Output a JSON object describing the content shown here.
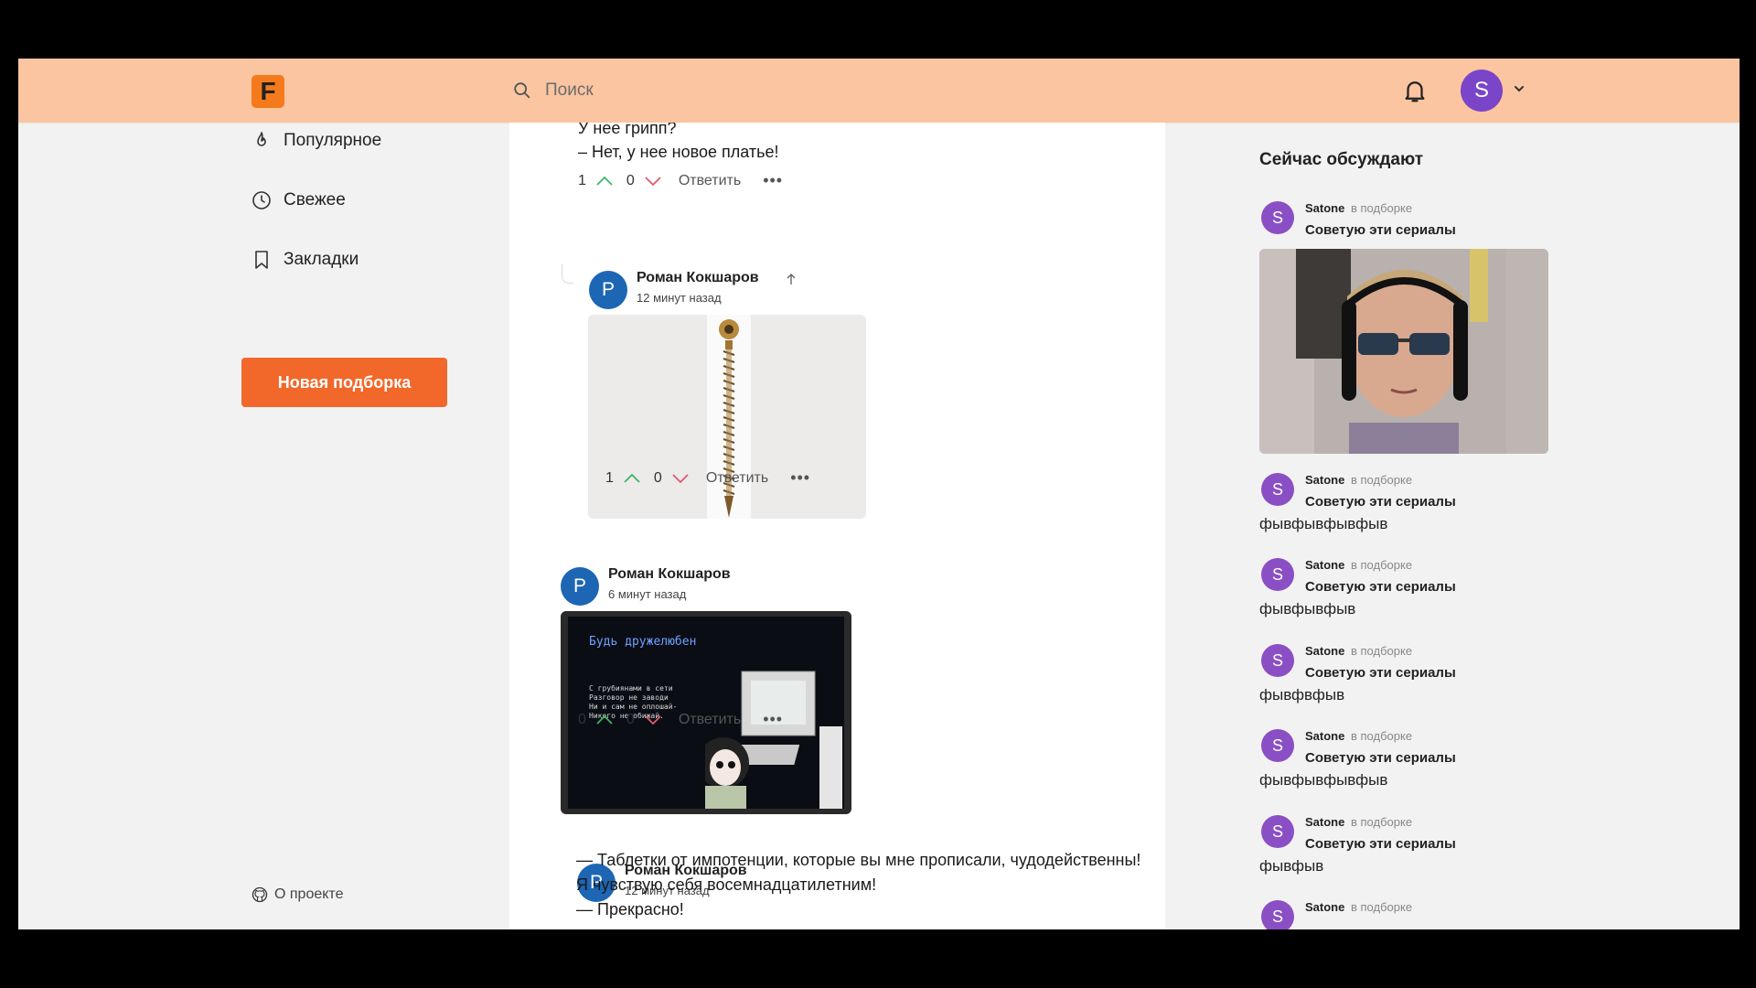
{
  "header": {
    "logo_letter": "F",
    "search_placeholder": "Поиск",
    "avatar_letter": "S"
  },
  "sidebar": {
    "items": [
      {
        "label": "Популярное",
        "icon": "flame-icon"
      },
      {
        "label": "Свежее",
        "icon": "clock-icon"
      },
      {
        "label": "Закладки",
        "icon": "bookmark-icon"
      }
    ],
    "new_button": "Новая подборка",
    "about": "О проекте"
  },
  "feed": {
    "top_text": [
      "У нее грипп?",
      "– Нет, у нее новое платье!"
    ],
    "comment0": {
      "up": "1",
      "down": "0",
      "reply": "Ответить",
      "more": "•••"
    },
    "comment1": {
      "avatar": "Р",
      "author": "Роман Кокшаров",
      "time": "12 минут назад",
      "up": "1",
      "down": "0",
      "reply": "Ответить",
      "more": "•••"
    },
    "comment2": {
      "avatar": "Р",
      "author": "Роман Кокшаров",
      "time": "6 минут назад",
      "image_title": "Будь дружелюбен",
      "image_lines": [
        "С грубиянами в сети",
        "Разговор не заводи",
        "Ни и сам не оплошай-",
        "Никого не обижай."
      ],
      "up": "0",
      "down": "0",
      "reply": "Ответить",
      "more": "•••"
    },
    "comment3": {
      "avatar": "Р",
      "author": "Роман Кокшаров",
      "time": "12 минут назад",
      "text": [
        "— Таблетки от импотенции, которые вы мне прописали, чудодейственны!",
        "Я чувствую себя восемнадцатилетним!",
        "— Прекрасно!"
      ]
    }
  },
  "right": {
    "title": "Сейчас обсуждают",
    "items": [
      {
        "avatar": "S",
        "user": "Satone",
        "in": "в подборке",
        "collection": "Советую эти сериалы",
        "text": ""
      },
      {
        "avatar": "S",
        "user": "Satone",
        "in": "в подборке",
        "collection": "Советую эти сериалы",
        "text": "фывфывфывфыв"
      },
      {
        "avatar": "S",
        "user": "Satone",
        "in": "в подборке",
        "collection": "Советую эти сериалы",
        "text": "фывфывфыв"
      },
      {
        "avatar": "S",
        "user": "Satone",
        "in": "в подборке",
        "collection": "Советую эти сериалы",
        "text": "фывфвфыв"
      },
      {
        "avatar": "S",
        "user": "Satone",
        "in": "в подборке",
        "collection": "Советую эти сериалы",
        "text": "фывфывфывфыв"
      },
      {
        "avatar": "S",
        "user": "Satone",
        "in": "в подборке",
        "collection": "Советую эти сериалы",
        "text": "фывфыв"
      },
      {
        "avatar": "S",
        "user": "Satone",
        "in": "в подборке",
        "collection": "",
        "text": ""
      }
    ]
  },
  "colors": {
    "header_bg": "#fac5a0",
    "accent": "#f2682a",
    "upvote": "#3bb56b",
    "downvote": "#e05a6e",
    "user_avatar": "#7a45c8",
    "author_avatar": "#1d66b4"
  }
}
